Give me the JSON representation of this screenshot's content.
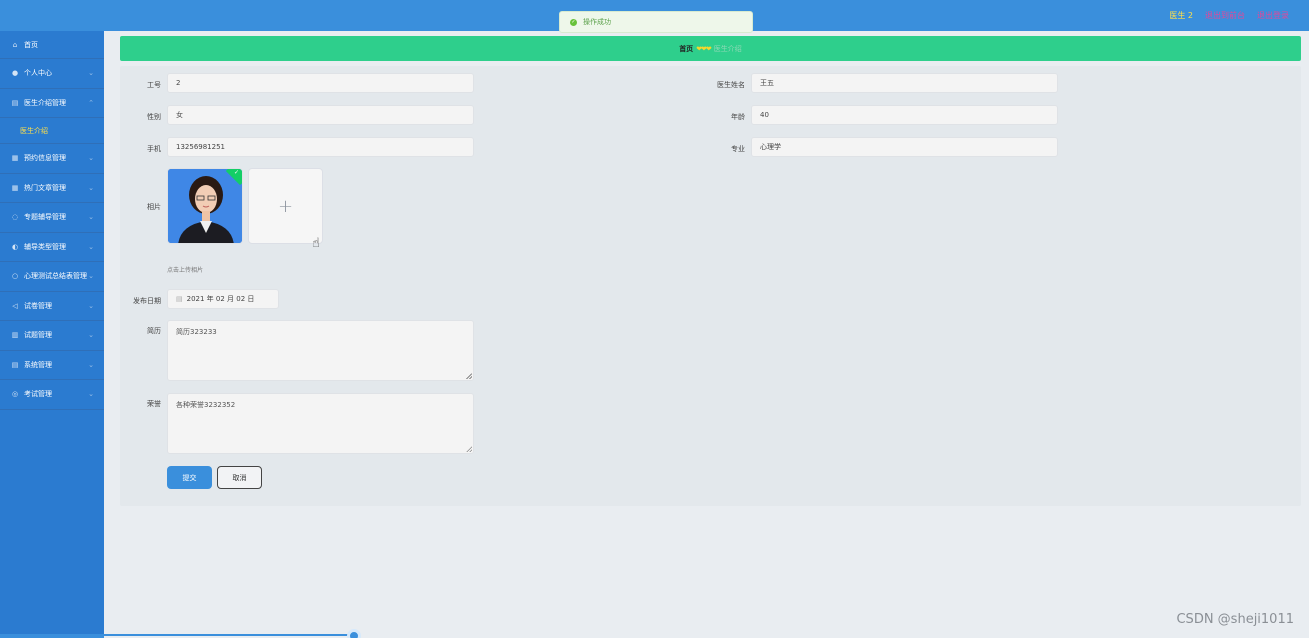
{
  "topbar": {
    "user": "医生 2",
    "link_backend": "退出到前台",
    "link_logout": "退出登录"
  },
  "toast": {
    "message": "操作成功"
  },
  "sidebar": {
    "items": [
      {
        "label": "首页",
        "icon": "home-icon"
      },
      {
        "label": "个人中心",
        "icon": "user-icon"
      },
      {
        "label": "医生介绍管理",
        "icon": "doctor-icon"
      },
      {
        "label": "预约信息管理",
        "icon": "calendar-icon"
      },
      {
        "label": "热门文章管理",
        "icon": "article-icon"
      },
      {
        "label": "专题辅导管理",
        "icon": "guide-icon"
      },
      {
        "label": "辅导类型管理",
        "icon": "category-icon"
      },
      {
        "label": "心理测试总结表管理",
        "icon": "test-icon"
      },
      {
        "label": "试卷管理",
        "icon": "paper-icon"
      },
      {
        "label": "试题管理",
        "icon": "question-icon"
      },
      {
        "label": "系统管理",
        "icon": "settings-icon"
      },
      {
        "label": "考试管理",
        "icon": "exam-icon"
      }
    ],
    "submenu_active": "医生介绍"
  },
  "breadcrumb": {
    "home": "首页",
    "current": "医生介绍"
  },
  "form": {
    "gonghao": {
      "label": "工号",
      "value": "2"
    },
    "yisheng_name": {
      "label": "医生姓名",
      "value": "王五"
    },
    "xingbie": {
      "label": "性别",
      "value": "女"
    },
    "nianling": {
      "label": "年龄",
      "value": "40"
    },
    "shouji": {
      "label": "手机",
      "value": "13256981251"
    },
    "zhuanye": {
      "label": "专业",
      "value": "心理学"
    },
    "zhaopian": {
      "label": "相片",
      "hint": "点击上传相片"
    },
    "fabu_date": {
      "label": "发布日期",
      "value": "2021 年 02 月 02 日"
    },
    "jianli": {
      "label": "简历",
      "value": "简历323233"
    },
    "rongyu": {
      "label": "荣誉",
      "value": "各种荣誉3232352"
    }
  },
  "buttons": {
    "submit": "提交",
    "cancel": "取消"
  },
  "watermark": "CSDN @sheji1011"
}
